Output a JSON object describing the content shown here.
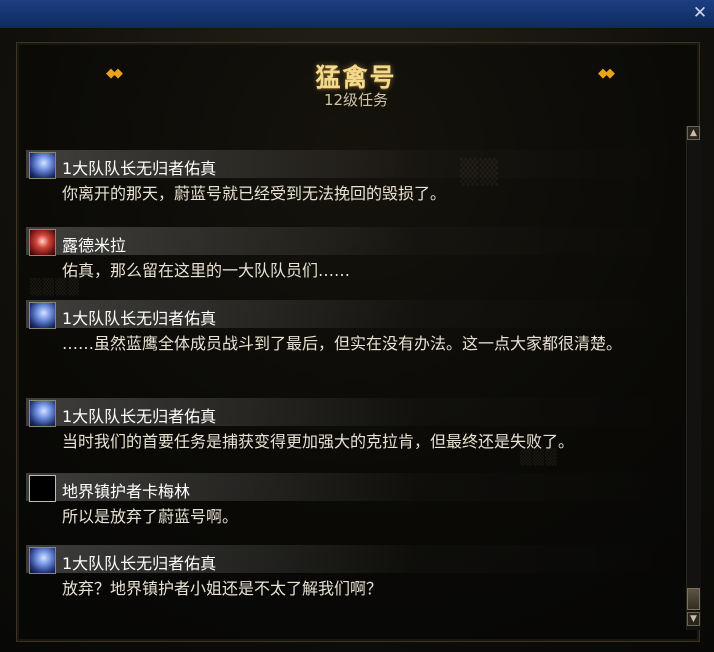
{
  "window": {
    "close_glyph": "✕"
  },
  "header": {
    "title": "猛禽号",
    "subtitle": "12级任务"
  },
  "dialog": [
    {
      "speaker": "1大队队长无归者佑真",
      "avatar": "blue-hair-avatar",
      "text": "你离开的那天，蔚蓝号就已经受到无法挽回的毁损了。"
    },
    {
      "speaker": "露德米拉",
      "avatar": "red-hair-avatar",
      "text": "佑真，那么留在这里的一大队队员们……"
    },
    {
      "speaker": "1大队队长无归者佑真",
      "avatar": "blue-hair-avatar",
      "text": "……虽然蓝鹰全体成员战斗到了最后，但实在没有办法。这一点大家都很清楚。"
    },
    {
      "speaker": "1大队队长无归者佑真",
      "avatar": "blue-hair-avatar",
      "text": "当时我们的首要任务是捕获变得更加强大的克拉肯，但最终还是失败了。"
    },
    {
      "speaker": "地界镇护者卡梅林",
      "avatar": "empty-avatar",
      "text": "所以是放弃了蔚蓝号啊。"
    },
    {
      "speaker": "1大队队长无归者佑真",
      "avatar": "blue-hair-avatar",
      "text": "放弃？地界镇护者小姐还是不太了解我们啊？"
    }
  ],
  "scrollbar": {
    "up_glyph": "▲",
    "down_glyph": "▼"
  }
}
